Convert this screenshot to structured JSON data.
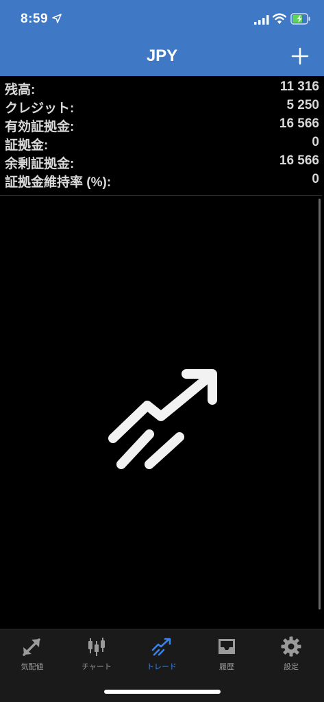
{
  "status_bar": {
    "time": "8:59",
    "icons": [
      "location-arrow-icon",
      "cellular-signal-icon",
      "wifi-icon",
      "battery-charging-icon"
    ]
  },
  "header": {
    "title": "JPY",
    "add_icon": "plus-icon",
    "background_color": "#3f78c5"
  },
  "summary": [
    {
      "label": "残高:",
      "value": "11 316"
    },
    {
      "label": "クレジット:",
      "value": "5 250"
    },
    {
      "label": "有効証拠金:",
      "value": "16 566"
    },
    {
      "label": "証拠金:",
      "value": "0"
    },
    {
      "label": "余剰証拠金:",
      "value": "16 566"
    },
    {
      "label": "証拠金維持率 (%):",
      "value": "0"
    }
  ],
  "empty_state": {
    "icon": "trend-up-icon"
  },
  "tabs": [
    {
      "label": "気配値",
      "icon": "quotes-arrows-icon",
      "active": false
    },
    {
      "label": "チャート",
      "icon": "candlestick-icon",
      "active": false
    },
    {
      "label": "トレード",
      "icon": "trade-trend-icon",
      "active": true
    },
    {
      "label": "履歴",
      "icon": "history-tray-icon",
      "active": false
    },
    {
      "label": "設定",
      "icon": "gear-icon",
      "active": false
    }
  ],
  "colors": {
    "accent": "#3a82e4",
    "tab_inactive": "#9a9a9a",
    "background": "#000000"
  }
}
